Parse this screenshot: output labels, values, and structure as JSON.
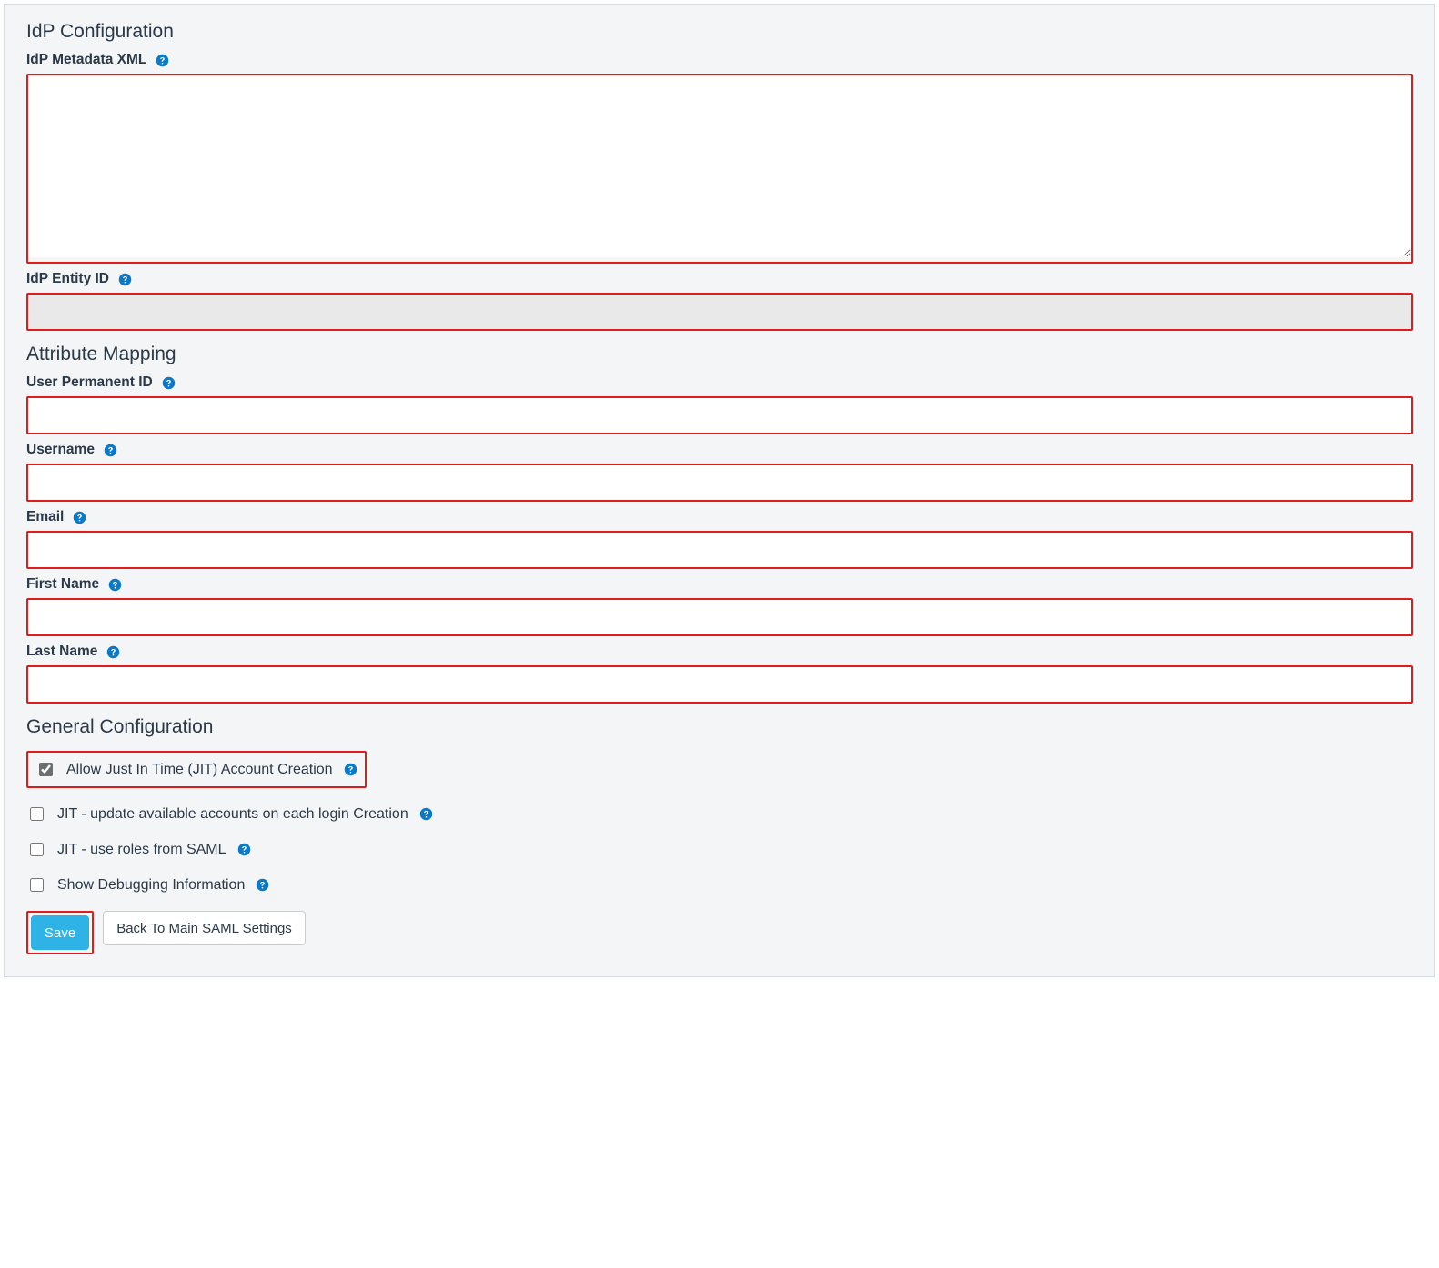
{
  "sections": {
    "idp": {
      "title": "IdP Configuration"
    },
    "attr": {
      "title": "Attribute Mapping"
    },
    "general": {
      "title": "General Configuration"
    }
  },
  "fields": {
    "metadata": {
      "label": "IdP Metadata XML",
      "value": ""
    },
    "entityId": {
      "label": "IdP Entity ID",
      "value": ""
    },
    "permId": {
      "label": "User Permanent ID",
      "value": ""
    },
    "username": {
      "label": "Username",
      "value": ""
    },
    "email": {
      "label": "Email",
      "value": ""
    },
    "firstName": {
      "label": "First Name",
      "value": ""
    },
    "lastName": {
      "label": "Last Name",
      "value": ""
    }
  },
  "checkboxes": {
    "jitCreate": {
      "label": "Allow Just In Time (JIT) Account Creation",
      "checked": true
    },
    "jitUpdate": {
      "label": "JIT - update available accounts on each login Creation",
      "checked": false
    },
    "jitRoles": {
      "label": "JIT - use roles from SAML",
      "checked": false
    },
    "debug": {
      "label": "Show Debugging Information",
      "checked": false
    }
  },
  "buttons": {
    "save": "Save",
    "back": "Back To Main SAML Settings"
  },
  "colors": {
    "highlight": "#e21b1b",
    "primary": "#2fb3e6",
    "helpIcon": "#0a79c8"
  }
}
